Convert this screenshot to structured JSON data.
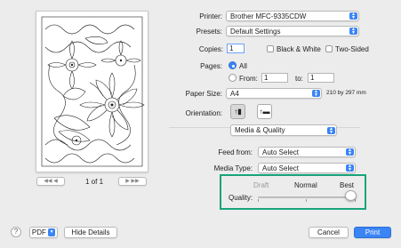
{
  "printer": {
    "label": "Printer:",
    "value": "Brother MFC-9335CDW"
  },
  "presets": {
    "label": "Presets:",
    "value": "Default Settings"
  },
  "copies": {
    "label": "Copies:",
    "value": "1",
    "bw_label": "Black & White",
    "twosided_label": "Two-Sided"
  },
  "pages": {
    "label": "Pages:",
    "all_label": "All",
    "from_label": "From:",
    "from_value": "1",
    "to_label": "to:",
    "to_value": "1"
  },
  "paper": {
    "label": "Paper Size:",
    "value": "A4",
    "dimensions": "210 by 297 mm"
  },
  "orientation": {
    "label": "Orientation:"
  },
  "section": {
    "value": "Media & Quality"
  },
  "feed": {
    "label": "Feed from:",
    "value": "Auto Select"
  },
  "media": {
    "label": "Media Type:",
    "value": "Auto Select"
  },
  "quality": {
    "label": "Quality:",
    "draft": "Draft",
    "normal": "Normal",
    "best": "Best",
    "level": 1.0
  },
  "preview": {
    "page_indicator": "1 of 1"
  },
  "footer": {
    "pdf_label": "PDF",
    "details_label": "Hide Details",
    "cancel_label": "Cancel",
    "print_label": "Print"
  },
  "icons": {
    "help": "help-icon",
    "portrait": "portrait-orientation-icon",
    "landscape": "landscape-orientation-icon"
  },
  "colors": {
    "accent": "#3a84f5",
    "highlight_box": "#1aa37a"
  }
}
